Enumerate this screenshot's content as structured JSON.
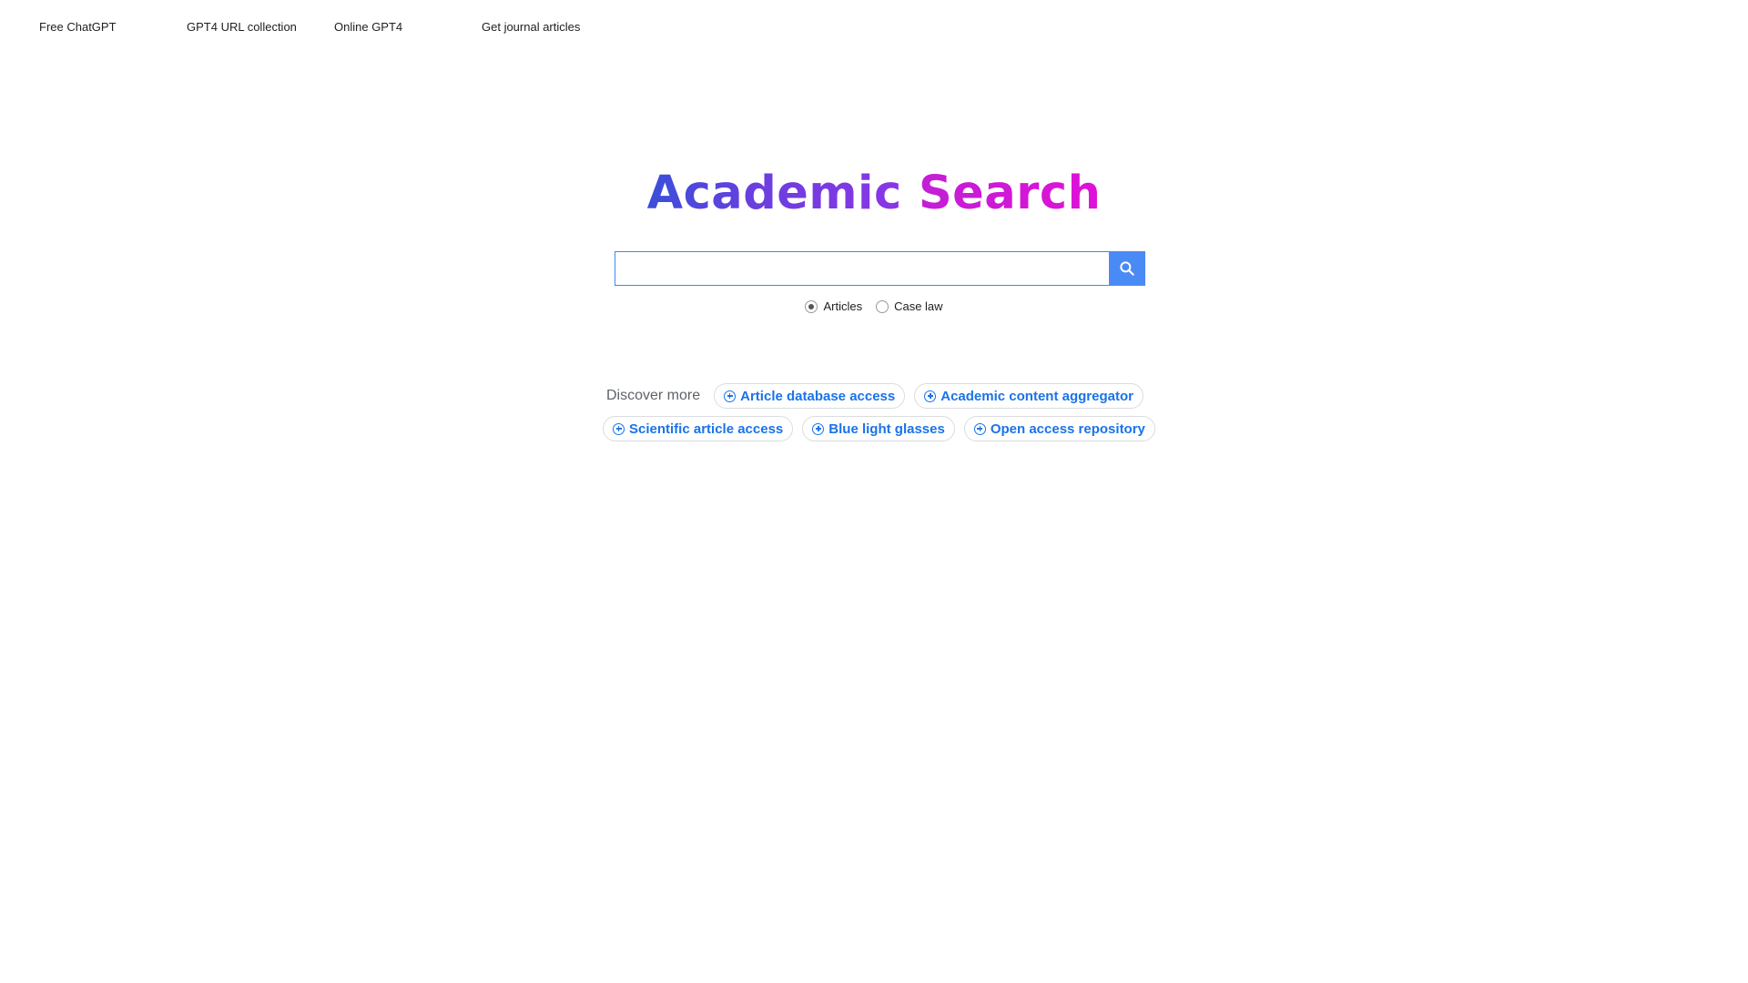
{
  "topnav": {
    "links": [
      "Free ChatGPT",
      "GPT4 URL collection",
      "Online GPT4",
      "Get journal articles"
    ]
  },
  "logo": {
    "word1": "Academic",
    "word2": "Search",
    "colors": {
      "word1": "#5b45dd",
      "word2": "#d918d8"
    }
  },
  "search": {
    "value": "",
    "placeholder": "",
    "button_icon": "search-icon",
    "accent": "#4a8af4"
  },
  "search_type": {
    "options": [
      {
        "label": "Articles",
        "checked": true
      },
      {
        "label": "Case law",
        "checked": false
      }
    ]
  },
  "discover": {
    "label": "Discover more",
    "chip_icon": "plus-circle-icon",
    "chips": [
      "Article database access",
      "Academic content aggregator",
      "Scientific article access",
      "Blue light glasses",
      "Open access repository"
    ],
    "chip_color": "#1a73e8"
  }
}
